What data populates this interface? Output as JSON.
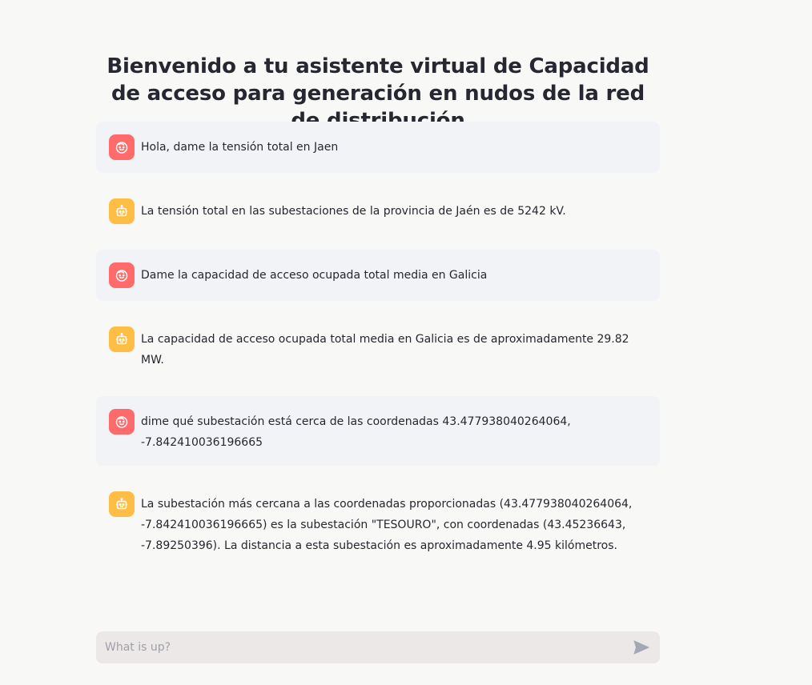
{
  "header": {
    "title": "Bienvenido a tu asistente virtual de Capacidad de acceso para generación en nudos de la red de distribución"
  },
  "messages": [
    {
      "role": "user",
      "icon": "user-face-icon",
      "text": "Hola, dame la tensión total en Jaen"
    },
    {
      "role": "assistant",
      "icon": "robot-icon",
      "text": "La tensión total en las subestaciones de la provincia de Jaén es de 5242 kV."
    },
    {
      "role": "user",
      "icon": "user-face-icon",
      "text": "Dame la capacidad de acceso ocupada total media en Galicia"
    },
    {
      "role": "assistant",
      "icon": "robot-icon",
      "text": "La capacidad de acceso ocupada total media en Galicia es de aproximadamente 29.82 MW."
    },
    {
      "role": "user",
      "icon": "user-face-icon",
      "text": "dime qué subestación está cerca de las coordenadas 43.477938040264064,\n-7.842410036196665"
    },
    {
      "role": "assistant",
      "icon": "robot-icon",
      "text": "La subestación más cercana a las coordenadas proporcionadas (43.477938040264064,\n-7.842410036196665) es la subestación \"TESOURO\", con coordenadas (43.45236643,\n-7.89250396). La distancia a esta subestación es aproximadamente 4.95 kilómetros."
    }
  ],
  "chat_input": {
    "placeholder": "What is up?",
    "value": "",
    "send_icon": "send-icon"
  },
  "colors": {
    "user_avatar": "#ff6b6b",
    "assistant_avatar": "#ffbd45",
    "user_bubble": "#f2f3f6",
    "input_bg": "#ede8e8"
  }
}
